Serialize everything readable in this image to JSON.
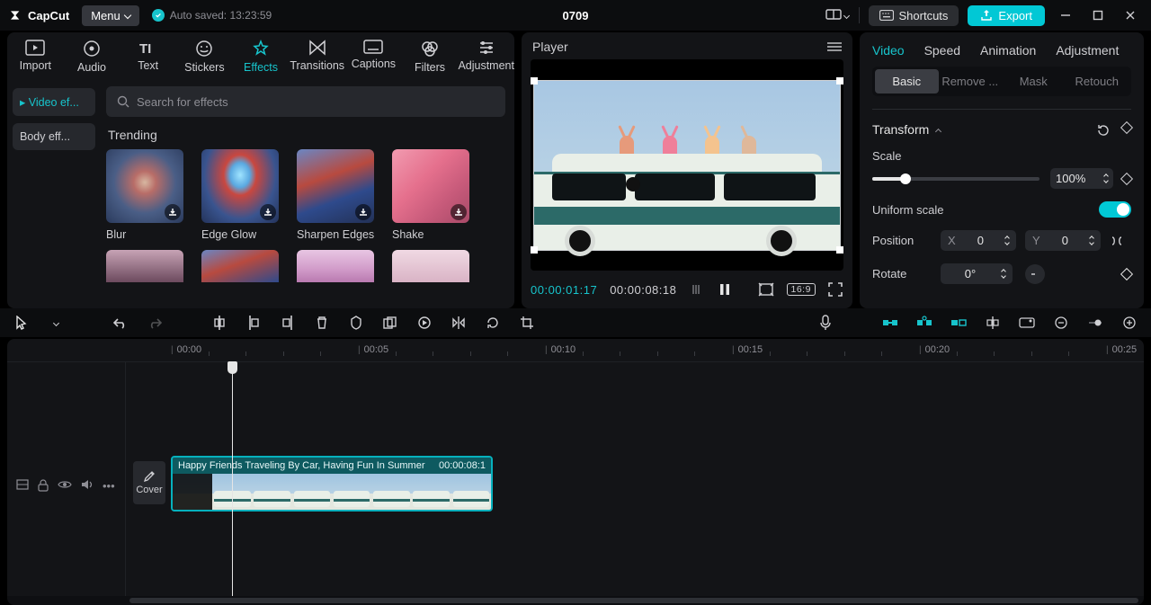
{
  "titlebar": {
    "app_name": "CapCut",
    "menu_label": "Menu",
    "autosave": "Auto saved: 13:23:59",
    "project_title": "0709",
    "shortcuts_label": "Shortcuts",
    "export_label": "Export"
  },
  "media_tabs": [
    {
      "id": "import",
      "label": "Import"
    },
    {
      "id": "audio",
      "label": "Audio"
    },
    {
      "id": "text",
      "label": "Text"
    },
    {
      "id": "stickers",
      "label": "Stickers"
    },
    {
      "id": "effects",
      "label": "Effects"
    },
    {
      "id": "transitions",
      "label": "Transitions"
    },
    {
      "id": "captions",
      "label": "Captions"
    },
    {
      "id": "filters",
      "label": "Filters"
    },
    {
      "id": "adjustment",
      "label": "Adjustment"
    }
  ],
  "effect_kinds": [
    {
      "id": "video",
      "label": "Video ef..."
    },
    {
      "id": "body",
      "label": "Body eff..."
    }
  ],
  "search_placeholder": "Search for effects",
  "effects_section_title": "Trending",
  "effects": [
    {
      "id": "blur",
      "label": "Blur"
    },
    {
      "id": "edge-glow",
      "label": "Edge Glow"
    },
    {
      "id": "sharpen",
      "label": "Sharpen Edges"
    },
    {
      "id": "shake",
      "label": "Shake"
    }
  ],
  "player": {
    "title": "Player",
    "current_tc": "00:00:01:17",
    "duration_tc": "00:00:08:18",
    "ratio": "16:9"
  },
  "inspector": {
    "tabs": [
      "Video",
      "Speed",
      "Animation",
      "Adjustment"
    ],
    "subtabs": [
      "Basic",
      "Remove ...",
      "Mask",
      "Retouch"
    ],
    "transform_label": "Transform",
    "scale_label": "Scale",
    "scale_value": "100%",
    "uniform_label": "Uniform scale",
    "position_label": "Position",
    "pos_x_axis": "X",
    "pos_x_value": "0",
    "pos_y_axis": "Y",
    "pos_y_value": "0",
    "rotate_label": "Rotate",
    "rotate_value": "0°"
  },
  "timeline": {
    "ticks": [
      "00:00",
      "00:05",
      "00:10",
      "00:15",
      "00:20",
      "00:25"
    ],
    "cover_label": "Cover",
    "clip_name": "Happy Friends Traveling By Car, Having Fun In Summer",
    "clip_duration": "00:00:08:1"
  }
}
